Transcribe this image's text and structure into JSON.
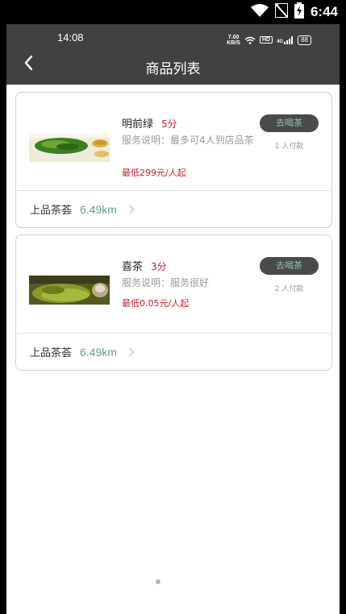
{
  "system_status": {
    "time": "6:44"
  },
  "inner_status": {
    "time": "14:08",
    "net_speed_value": "7.00",
    "net_speed_unit": "KB/S",
    "hd_label": "HD",
    "signal_label": "4G",
    "battery": "88"
  },
  "header": {
    "title": "商品列表"
  },
  "products": [
    {
      "name": "明前绿",
      "score": "5分",
      "description": "服务说明：最多可4人到店品茶",
      "price": "最低299元/人起",
      "action_label": "去喝茶",
      "paid_count": "1 人付款",
      "shop_name": "上品茶荟",
      "distance": "6.49km"
    },
    {
      "name": "喜茶",
      "score": "3分",
      "description": "服务说明：服务很好",
      "price": "最低0.05元/人起",
      "action_label": "去喝茶",
      "paid_count": "2 人付款",
      "shop_name": "上品茶荟",
      "distance": "6.49km"
    }
  ],
  "colors": {
    "header_bg": "#414141",
    "accent_red": "#c8202e",
    "distance_green": "#5f9f8e",
    "button_bg": "#4a4a4a",
    "button_text": "#8fc2a6"
  }
}
